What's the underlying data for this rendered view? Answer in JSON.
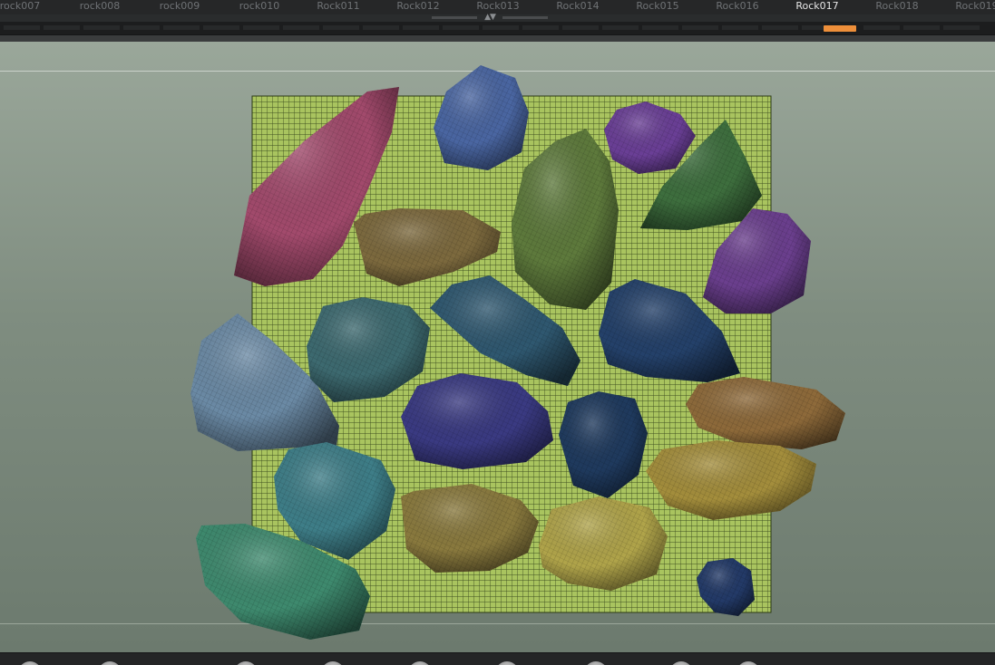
{
  "subtool_tabs": [
    {
      "label": "rock007",
      "active": false
    },
    {
      "label": "rock008",
      "active": false
    },
    {
      "label": "rock009",
      "active": false
    },
    {
      "label": "rock010",
      "active": false
    },
    {
      "label": "Rock011",
      "active": false
    },
    {
      "label": "Rock012",
      "active": false
    },
    {
      "label": "Rock013",
      "active": false
    },
    {
      "label": "Rock014",
      "active": false
    },
    {
      "label": "Rock015",
      "active": false
    },
    {
      "label": "Rock016",
      "active": false
    },
    {
      "label": "Rock017",
      "active": true
    },
    {
      "label": "Rock018",
      "active": false
    },
    {
      "label": "Rock019",
      "active": false
    }
  ],
  "collapse_handle": {
    "icon": "triangle-up-down-icon",
    "glyph": "▲▼"
  },
  "colors": {
    "accent": "#ee8f3a",
    "active_text": "#e6e6e6",
    "inactive_text": "#6f7275",
    "ground_mesh": "#a9c45f",
    "viewport_bg": "#8b988b"
  },
  "bottom_shelf": {
    "dial_count": 12
  }
}
